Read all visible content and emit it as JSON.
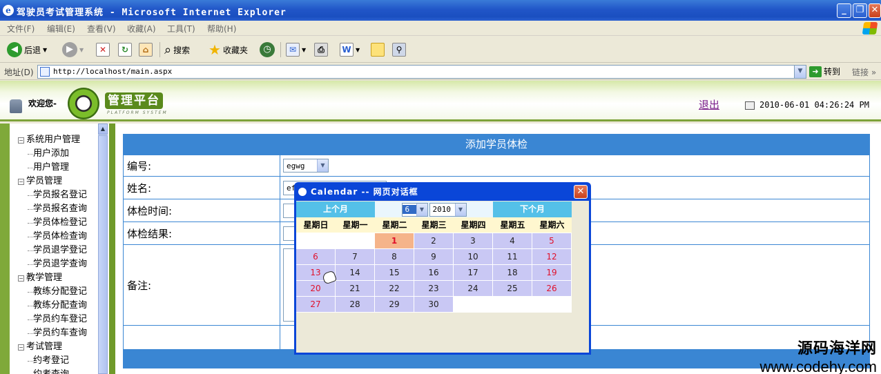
{
  "window": {
    "title": "驾驶员考试管理系统 - Microsoft Internet Explorer"
  },
  "menu": [
    "文件(F)",
    "编辑(E)",
    "查看(V)",
    "收藏(A)",
    "工具(T)",
    "帮助(H)"
  ],
  "toolbar": {
    "back": "后退",
    "search": "搜索",
    "favorites": "收藏夹"
  },
  "address": {
    "label": "地址(D)",
    "url": "http://localhost/main.aspx",
    "go": "转到",
    "links": "链接"
  },
  "header": {
    "welcome": "欢迎您-",
    "logo_title": "管理平台",
    "logo_sub": "PLATFORM SYSTEM",
    "logout": "退出",
    "datetime": "2010-06-01 04:26:24 PM"
  },
  "sidebar": {
    "groups": [
      {
        "label": "系统用户管理",
        "items": [
          "用户添加",
          "用户管理"
        ]
      },
      {
        "label": "学员管理",
        "items": [
          "学员报名登记",
          "学员报名查询",
          "学员体检登记",
          "学员体检查询",
          "学员退学登记",
          "学员退学查询"
        ]
      },
      {
        "label": "教学管理",
        "items": [
          "教练分配登记",
          "教练分配查询",
          "学员约车登记",
          "学员约车查询"
        ]
      },
      {
        "label": "考试管理",
        "items": [
          "约考登记",
          "约考查询"
        ]
      }
    ]
  },
  "form": {
    "title": "添加学员体检",
    "labels": {
      "id": "编号:",
      "name": "姓名:",
      "time": "体检时间:",
      "result": "体检结果:",
      "remark": "备注:"
    },
    "id_value": "egwg",
    "name_value": "ef"
  },
  "calendar": {
    "title": "Calendar -- 网页对话框",
    "prev": "上个月",
    "next": "下个月",
    "month": "6",
    "year": "2010",
    "weekdays": [
      "星期日",
      "星期一",
      "星期二",
      "星期三",
      "星期四",
      "星期五",
      "星期六"
    ],
    "first_weekday": 2,
    "days_in_month": 30,
    "today": 1
  },
  "watermark": {
    "line1": "源码海洋网",
    "line2": "www.codehy.com"
  }
}
